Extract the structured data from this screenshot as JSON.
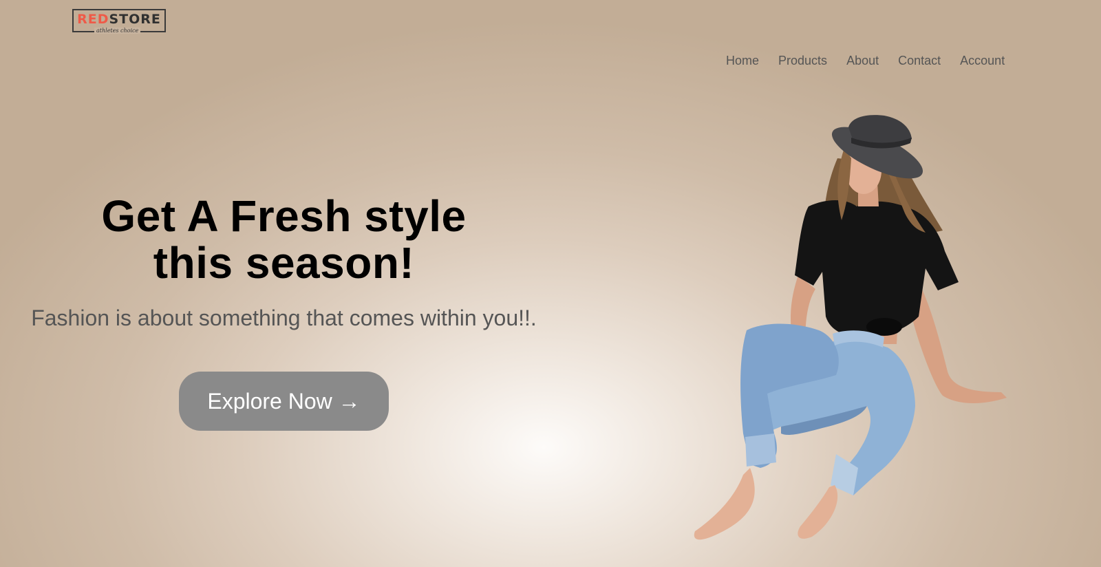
{
  "logo": {
    "brand_red": "RED",
    "brand_dark": "STORE",
    "tagline": "athletes choice"
  },
  "nav": {
    "items": [
      "Home",
      "Products",
      "About",
      "Contact",
      "Account"
    ]
  },
  "hero": {
    "title_line1": "Get A Fresh style",
    "title_line2": "this season!",
    "subtitle": "Fashion is about something that comes within you!!.",
    "cta_label": "Explore Now →"
  },
  "colors": {
    "brand_accent": "#ef5a48",
    "button_bg": "#8a8a8a",
    "nav_text": "#555555"
  },
  "icons": {
    "hero_image": "woman-sitting-image"
  }
}
